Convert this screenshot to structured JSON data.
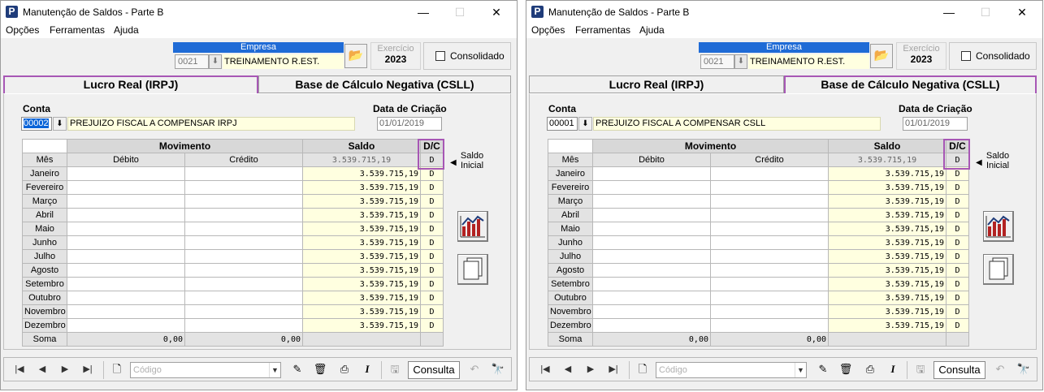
{
  "windows": [
    {
      "title": "Manutenção de Saldos - Parte B",
      "controls": {
        "minimize": "—",
        "maximize": "☐",
        "close": "✕"
      },
      "menu": [
        "Opções",
        "Ferramentas",
        "Ajuda"
      ],
      "empresa": {
        "header": "Empresa",
        "code": "0021",
        "name": "TREINAMENTO R.EST."
      },
      "exercicio": {
        "label": "Exercício",
        "value": "2023"
      },
      "consolidado": {
        "label": "Consolidado",
        "checked": false
      },
      "tabs": [
        {
          "label": "Lucro Real (IRPJ)",
          "active": true
        },
        {
          "label": "Base de Cálculo Negativa (CSLL)",
          "active": false
        }
      ],
      "highlighted_tab": 0,
      "conta": {
        "label": "Conta",
        "code": "00002",
        "name": "PREJUIZO FISCAL A COMPENSAR IRPJ",
        "selected": true
      },
      "data_criacao": {
        "label": "Data de Criação",
        "value": "01/01/2019"
      },
      "grid": {
        "group_headers": {
          "movimento": "Movimento",
          "saldo": "Saldo",
          "dc": "D/C"
        },
        "col_headers": {
          "mes": "Mês",
          "debito": "Débito",
          "credito": "Crédito"
        },
        "saldo_inicial": {
          "saldo": "3.539.715,19",
          "dc": "D"
        },
        "rows": [
          {
            "mes": "Janeiro",
            "saldo": "3.539.715,19",
            "dc": "D"
          },
          {
            "mes": "Fevereiro",
            "saldo": "3.539.715,19",
            "dc": "D"
          },
          {
            "mes": "Março",
            "saldo": "3.539.715,19",
            "dc": "D"
          },
          {
            "mes": "Abril",
            "saldo": "3.539.715,19",
            "dc": "D"
          },
          {
            "mes": "Maio",
            "saldo": "3.539.715,19",
            "dc": "D"
          },
          {
            "mes": "Junho",
            "saldo": "3.539.715,19",
            "dc": "D"
          },
          {
            "mes": "Julho",
            "saldo": "3.539.715,19",
            "dc": "D"
          },
          {
            "mes": "Agosto",
            "saldo": "3.539.715,19",
            "dc": "D"
          },
          {
            "mes": "Setembro",
            "saldo": "3.539.715,19",
            "dc": "D"
          },
          {
            "mes": "Outubro",
            "saldo": "3.539.715,19",
            "dc": "D"
          },
          {
            "mes": "Novembro",
            "saldo": "3.539.715,19",
            "dc": "D"
          },
          {
            "mes": "Dezembro",
            "saldo": "3.539.715,19",
            "dc": "D"
          }
        ],
        "soma": {
          "label": "Soma",
          "debito": "0,00",
          "credito": "0,00"
        }
      },
      "saldo_inicial_label": [
        "Saldo",
        "Inicial"
      ],
      "toolbar": {
        "codigo_placeholder": "Código",
        "mode": "Consulta"
      }
    },
    {
      "title": "Manutenção de Saldos - Parte B",
      "controls": {
        "minimize": "—",
        "maximize": "☐",
        "close": "✕"
      },
      "menu": [
        "Opções",
        "Ferramentas",
        "Ajuda"
      ],
      "empresa": {
        "header": "Empresa",
        "code": "0021",
        "name": "TREINAMENTO R.EST."
      },
      "exercicio": {
        "label": "Exercício",
        "value": "2023"
      },
      "consolidado": {
        "label": "Consolidado",
        "checked": false
      },
      "tabs": [
        {
          "label": "Lucro Real (IRPJ)",
          "active": false
        },
        {
          "label": "Base de Cálculo Negativa (CSLL)",
          "active": true
        }
      ],
      "highlighted_tab": 1,
      "conta": {
        "label": "Conta",
        "code": "00001",
        "name": "PREJUIZO FISCAL A COMPENSAR CSLL",
        "selected": false
      },
      "data_criacao": {
        "label": "Data de Criação",
        "value": "01/01/2019"
      },
      "grid": {
        "group_headers": {
          "movimento": "Movimento",
          "saldo": "Saldo",
          "dc": "D/C"
        },
        "col_headers": {
          "mes": "Mês",
          "debito": "Débito",
          "credito": "Crédito"
        },
        "saldo_inicial": {
          "saldo": "3.539.715,19",
          "dc": "D"
        },
        "rows": [
          {
            "mes": "Janeiro",
            "saldo": "3.539.715,19",
            "dc": "D"
          },
          {
            "mes": "Fevereiro",
            "saldo": "3.539.715,19",
            "dc": "D"
          },
          {
            "mes": "Março",
            "saldo": "3.539.715,19",
            "dc": "D"
          },
          {
            "mes": "Abril",
            "saldo": "3.539.715,19",
            "dc": "D"
          },
          {
            "mes": "Maio",
            "saldo": "3.539.715,19",
            "dc": "D"
          },
          {
            "mes": "Junho",
            "saldo": "3.539.715,19",
            "dc": "D"
          },
          {
            "mes": "Julho",
            "saldo": "3.539.715,19",
            "dc": "D"
          },
          {
            "mes": "Agosto",
            "saldo": "3.539.715,19",
            "dc": "D"
          },
          {
            "mes": "Setembro",
            "saldo": "3.539.715,19",
            "dc": "D"
          },
          {
            "mes": "Outubro",
            "saldo": "3.539.715,19",
            "dc": "D"
          },
          {
            "mes": "Novembro",
            "saldo": "3.539.715,19",
            "dc": "D"
          },
          {
            "mes": "Dezembro",
            "saldo": "3.539.715,19",
            "dc": "D"
          }
        ],
        "soma": {
          "label": "Soma",
          "debito": "0,00",
          "credito": "0,00"
        }
      },
      "saldo_inicial_label": [
        "Saldo",
        "Inicial"
      ],
      "toolbar": {
        "codigo_placeholder": "Código",
        "mode": "Consulta"
      }
    }
  ],
  "colors": {
    "highlight": "#a757b5",
    "empresa_header": "#1f6bd6",
    "saldo_bg": "#ffffe0"
  }
}
